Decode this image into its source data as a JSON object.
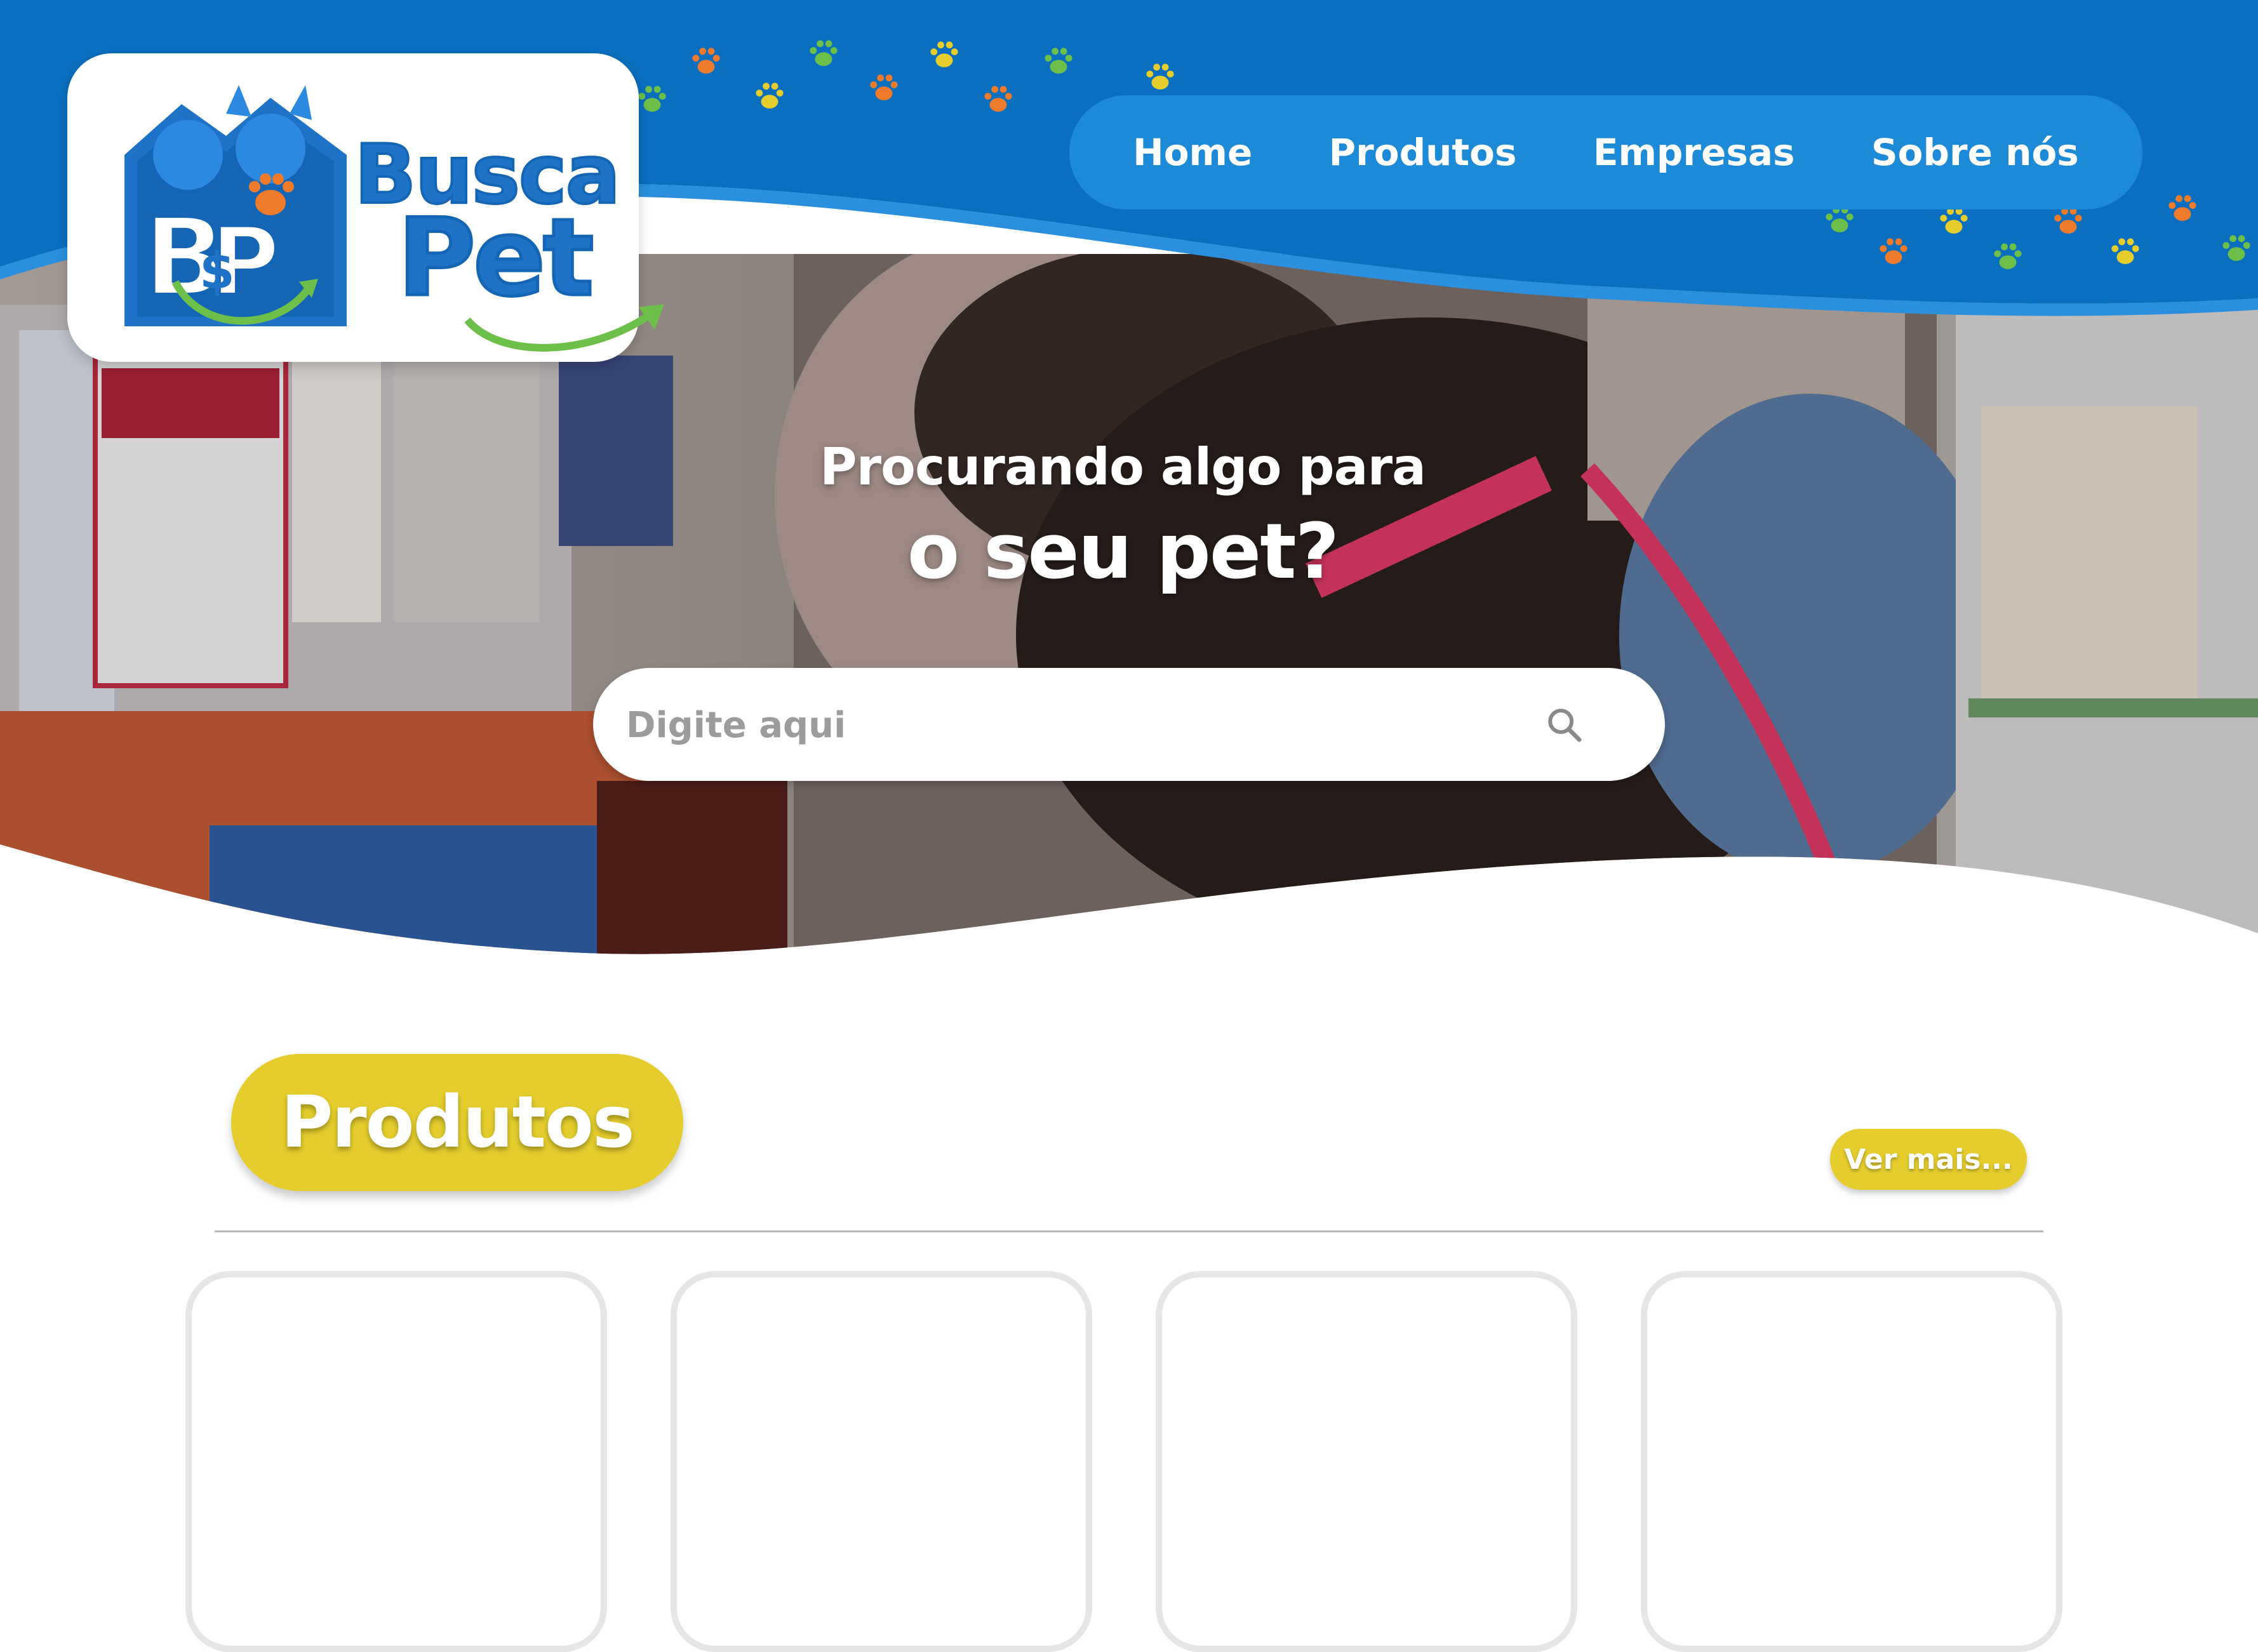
{
  "brand": {
    "name_top": "Busca",
    "name_bottom": "Pet",
    "colors": {
      "primary_blue": "#0a6fbe",
      "nav_blue": "#1d8ad7",
      "accent_yellow": "#e4cd2d",
      "accent_green": "#6cc04a",
      "accent_orange": "#ee7b2c"
    }
  },
  "nav": {
    "items": [
      {
        "label": "Home"
      },
      {
        "label": "Produtos"
      },
      {
        "label": "Empresas"
      },
      {
        "label": "Sobre nós"
      }
    ]
  },
  "hero": {
    "line1": "Procurando algo para",
    "line2": "o seu pet?",
    "search_placeholder": "Digite aqui",
    "search_icon": "search-icon"
  },
  "products": {
    "title": "Produtos",
    "more_label": "Ver mais...",
    "cards": [
      {},
      {},
      {},
      {}
    ]
  }
}
